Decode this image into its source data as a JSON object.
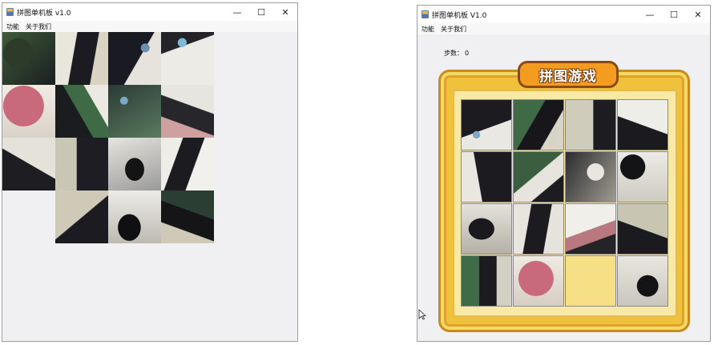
{
  "windows": [
    {
      "title": "拼图单机板 v1.0",
      "menus": [
        "功能",
        "关于我们"
      ],
      "controls": [
        "minimize-icon",
        "maximize-icon",
        "close-icon"
      ],
      "tile_grid": {
        "rows": 4,
        "cols": 4,
        "empty": [
          12
        ]
      }
    },
    {
      "title": "拼图单机板 V1.0",
      "menus": [
        "功能",
        "关于我们"
      ],
      "controls": [
        "minimize-icon",
        "maximize-icon",
        "close-icon"
      ],
      "steps_label": "步数：",
      "steps_value": "0",
      "banner": "拼图游戏",
      "tile_grid": {
        "rows": 4,
        "cols": 4,
        "empty": [
          14
        ]
      }
    }
  ],
  "glyphs": {
    "minimize": "—",
    "maximize": "☐",
    "close": "✕"
  },
  "colors": {
    "frame_gold": "#f0c13c",
    "banner_orange": "#f39c1f",
    "empty_tile": "#f7df86"
  }
}
